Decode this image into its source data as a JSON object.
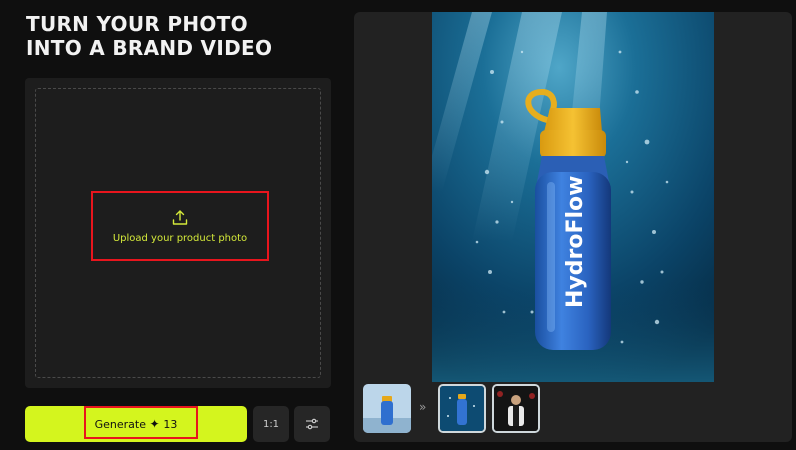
{
  "header": {
    "title_line1": "TURN YOUR PHOTO",
    "title_line2": "INTO A BRAND VIDEO"
  },
  "upload": {
    "icon": "upload-icon",
    "label": "Upload your product photo"
  },
  "actions": {
    "generate_label": "Generate",
    "credits": "13",
    "ratio_label": "1:1",
    "settings_icon": "sliders-icon"
  },
  "preview": {
    "bottle_brand": "HydroFlow",
    "thumbnail_arrow": "»"
  },
  "colors": {
    "accent": "#d4f51e",
    "highlight_red": "#e8151d",
    "upload_text": "#d4e93a",
    "panel_bg": "#1d1d1d",
    "page_bg": "#0f0f0f"
  }
}
